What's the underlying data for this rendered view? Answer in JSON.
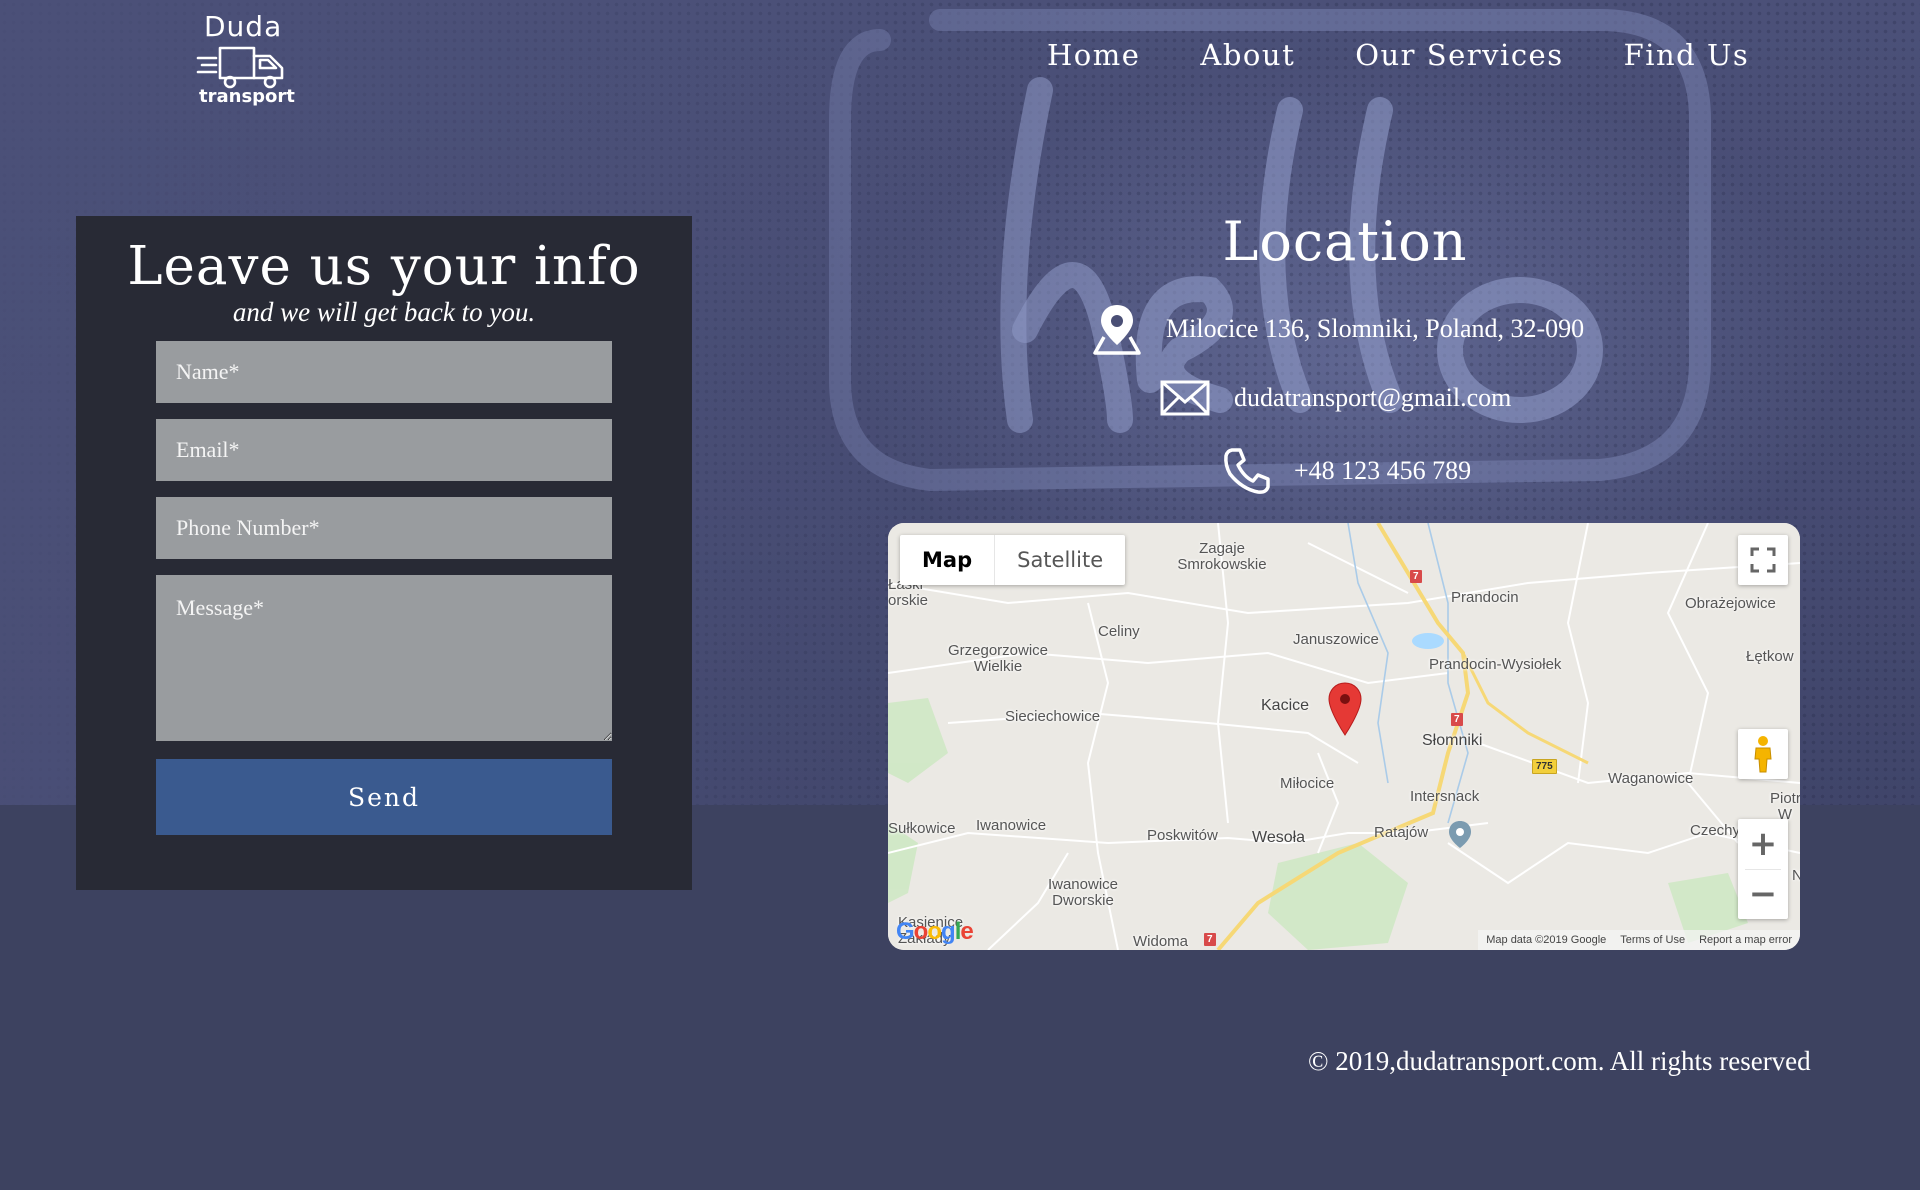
{
  "logo": {
    "name": "Duda",
    "sub": "transport"
  },
  "nav": {
    "items": [
      "Home",
      "About",
      "Our Services",
      "Find Us"
    ]
  },
  "form": {
    "title": "Leave us your info",
    "subtitle": "and we will get back to you.",
    "name_placeholder": "Name*",
    "email_placeholder": "Email*",
    "phone_placeholder": "Phone Number*",
    "message_placeholder": "Message*",
    "send_label": "Send"
  },
  "location": {
    "title": "Location",
    "address": "Milocice 136, Slomniki, Poland, 32-090",
    "email": "dudatransport@gmail.com",
    "phone": "+48 123 456 789"
  },
  "map": {
    "type_map": "Map",
    "type_satellite": "Satellite",
    "zoom_in": "+",
    "zoom_out": "−",
    "labels": [
      "Zagaje Smrokowskie",
      "Prandocin",
      "Obrażejowice",
      "Łaski orskie",
      "Celiny",
      "Januszowice",
      "Grzegorzowice Wielkie",
      "Prandocin-Wysiołek",
      "Łętkow",
      "Kacice",
      "Sieciechowice",
      "Słomniki",
      "Waganowice",
      "Miłocice",
      "Intersnack",
      "Piotr W",
      "Sułkowice",
      "Iwanowice",
      "Poskwitów",
      "Wesoła",
      "Ratajów",
      "Czechy",
      "Iwanowice Dworskie",
      "Kasienice Zakłady",
      "Widoma",
      "N"
    ],
    "shields": [
      "7",
      "7",
      "775",
      "7"
    ],
    "attribution": [
      "Map data ©2019 Google",
      "Terms of Use",
      "Report a map error"
    ],
    "logo": "Google",
    "accent_marker": "#e53935"
  },
  "footer": {
    "text": "© 2019,dudatransport.com. All rights reserved"
  },
  "colors": {
    "page_bg": "#3d4260",
    "panel_bg": "#282a35",
    "field_bg": "#999c9f",
    "button_bg": "#3a5a8f"
  }
}
